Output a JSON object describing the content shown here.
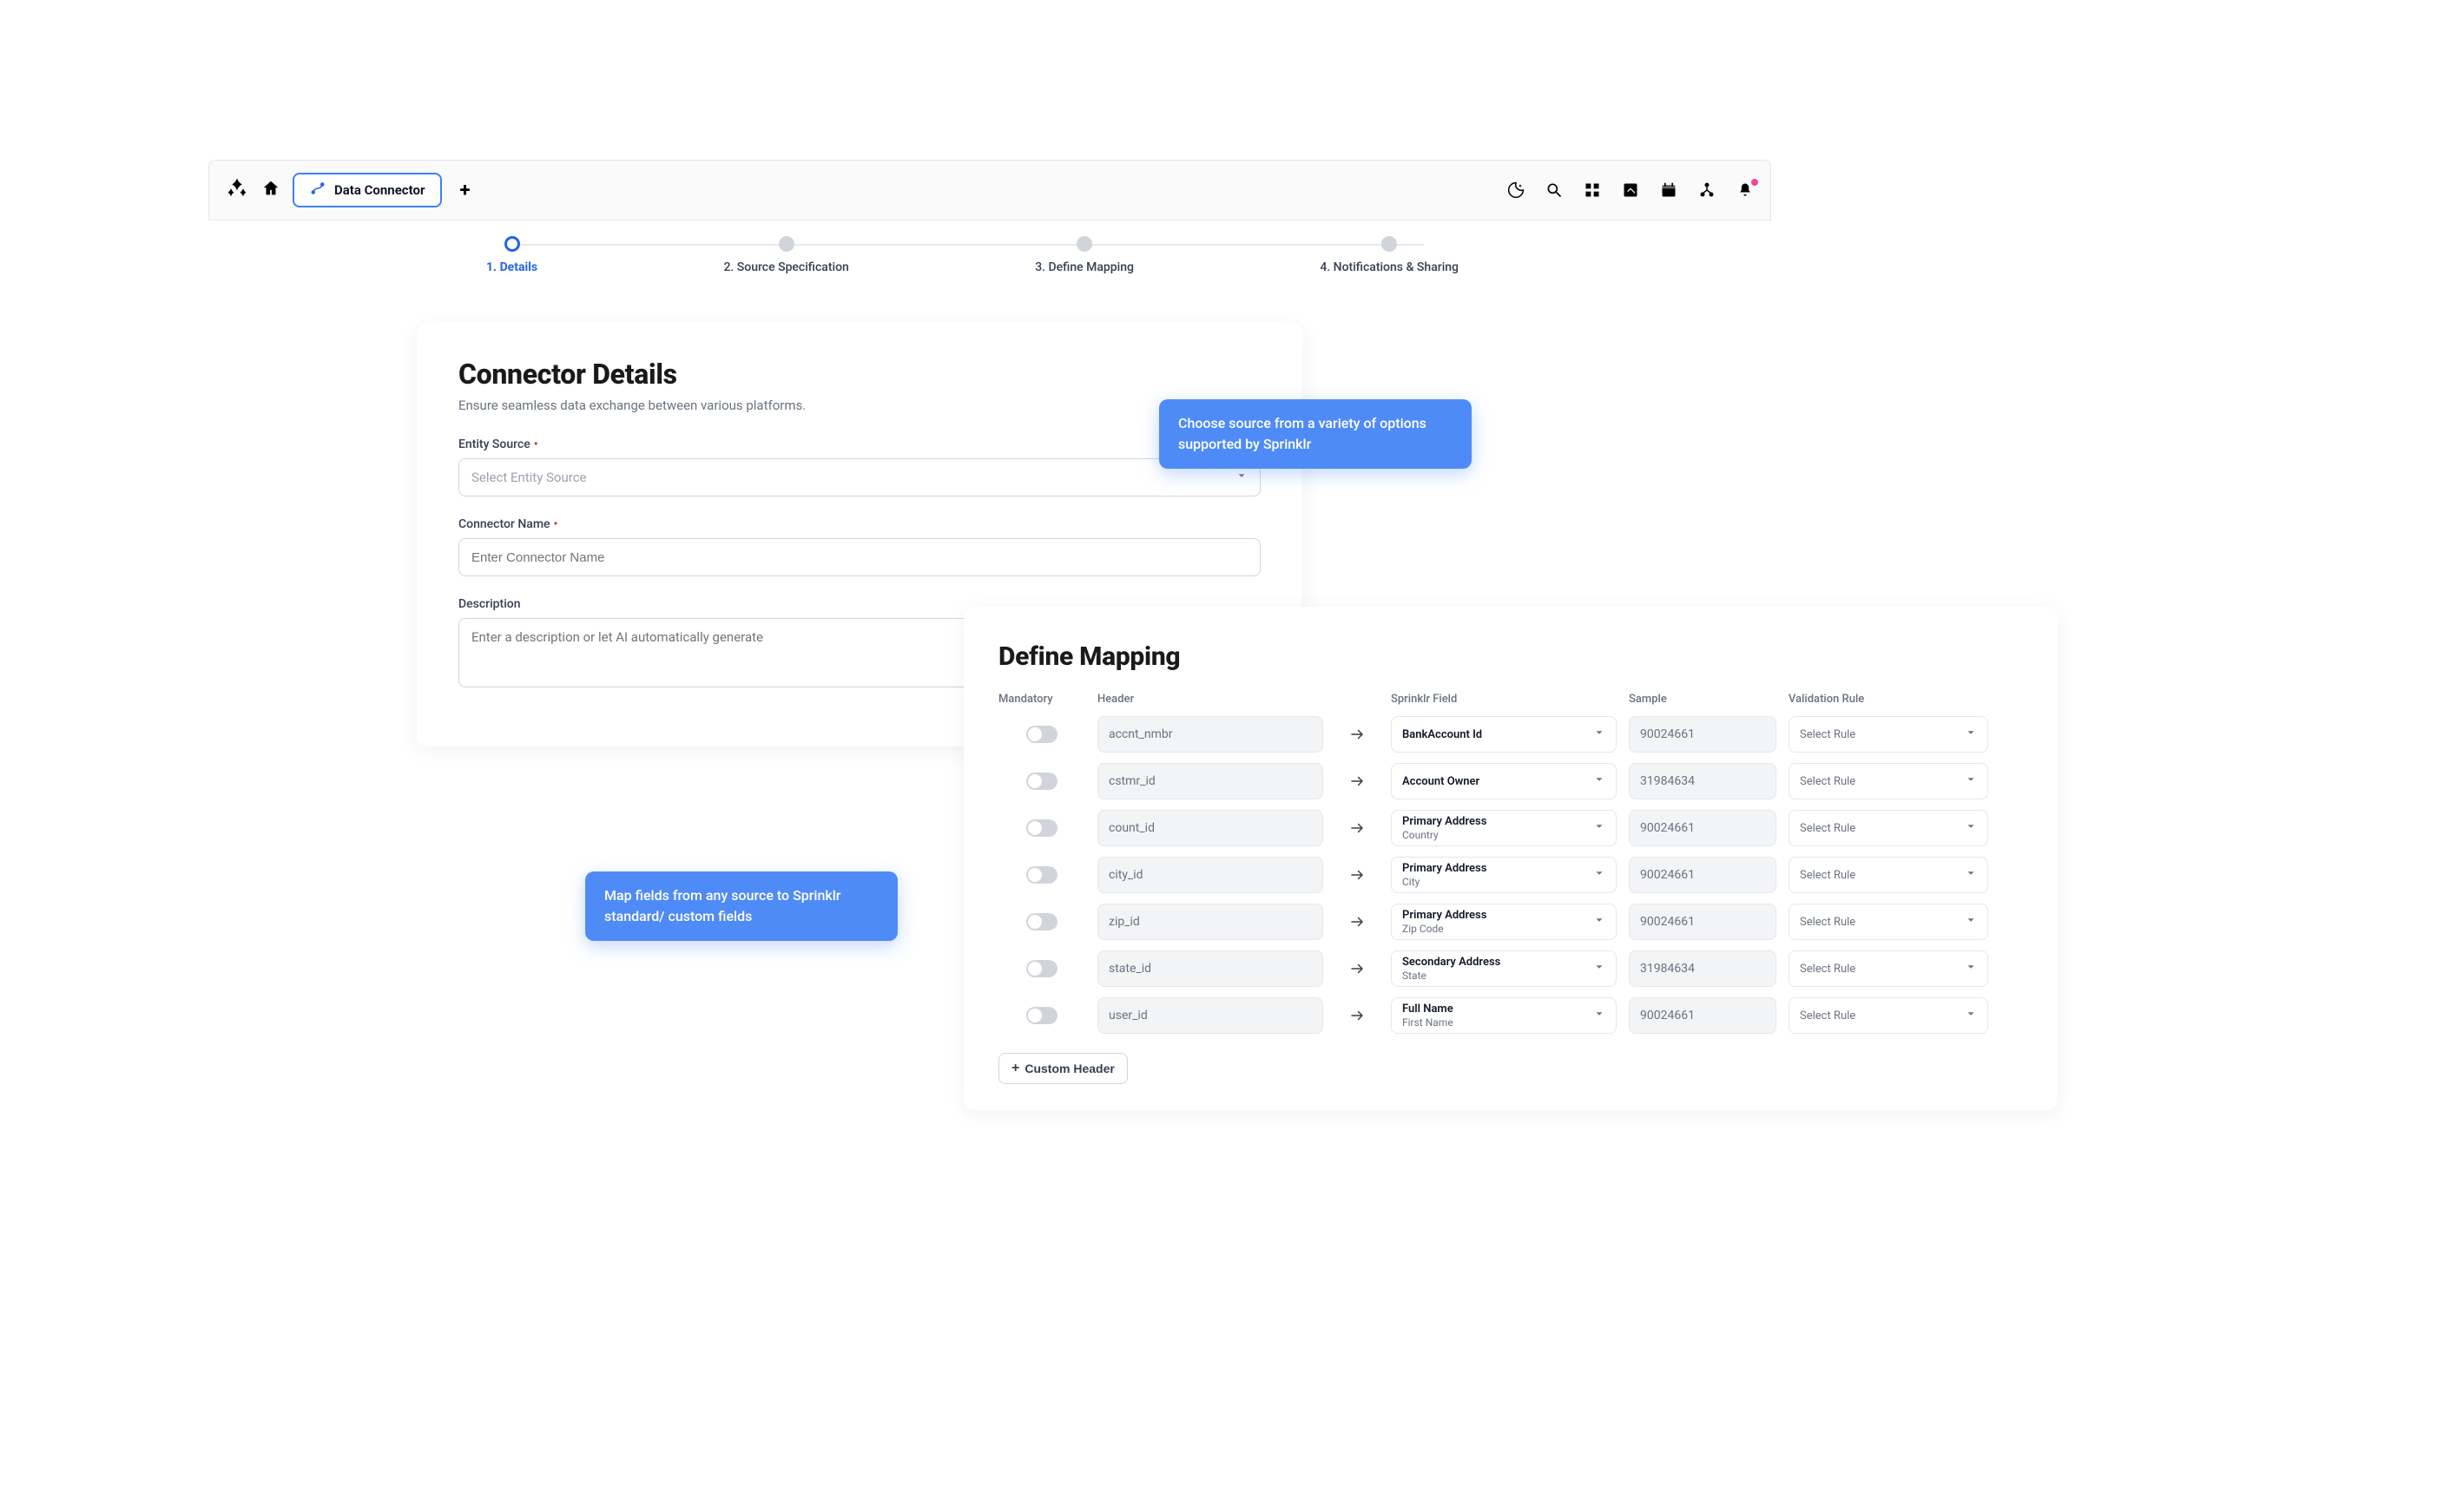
{
  "topbar": {
    "tab_label": "Data Connector"
  },
  "stepper": {
    "steps": [
      {
        "label": "1. Details",
        "active": true
      },
      {
        "label": "2. Source Specification",
        "active": false
      },
      {
        "label": "3. Define Mapping",
        "active": false
      },
      {
        "label": "4. Notifications & Sharing",
        "active": false
      }
    ]
  },
  "details": {
    "title": "Connector Details",
    "subtitle": "Ensure seamless data exchange between various platforms.",
    "entity_source_label": "Entity Source",
    "entity_source_placeholder": "Select Entity Source",
    "connector_name_label": "Connector Name",
    "connector_name_placeholder": "Enter Connector Name",
    "description_label": "Description",
    "description_placeholder": "Enter a description or let AI automatically generate"
  },
  "tooltips": {
    "source": "Choose source from a variety of options supported by Sprinklr",
    "mapping": "Map fields from any source to Sprinklr standard/ custom fields"
  },
  "mapping": {
    "title": "Define Mapping",
    "columns": {
      "mandatory": "Mandatory",
      "header": "Header",
      "sprinklr_field": "Sprinklr Field",
      "sample": "Sample",
      "validation": "Validation Rule"
    },
    "custom_header_btn": "Custom Header",
    "rule_placeholder": "Select Rule",
    "rows": [
      {
        "header": "accnt_nmbr",
        "field_primary": "BankAccount Id",
        "field_secondary": "",
        "sample": "90024661"
      },
      {
        "header": "cstmr_id",
        "field_primary": "Account Owner",
        "field_secondary": "",
        "sample": "31984634"
      },
      {
        "header": "count_id",
        "field_primary": "Primary Address",
        "field_secondary": "Country",
        "sample": "90024661"
      },
      {
        "header": "city_id",
        "field_primary": "Primary Address",
        "field_secondary": "City",
        "sample": "90024661"
      },
      {
        "header": "zip_id",
        "field_primary": "Primary Address",
        "field_secondary": "Zip Code",
        "sample": "90024661"
      },
      {
        "header": "state_id",
        "field_primary": "Secondary Address",
        "field_secondary": "State",
        "sample": "31984634"
      },
      {
        "header": "user_id",
        "field_primary": "Full Name",
        "field_secondary": "First Name",
        "sample": "90024661"
      }
    ]
  }
}
